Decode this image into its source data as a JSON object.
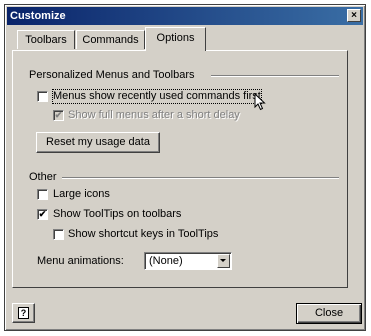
{
  "window": {
    "title": "Customize",
    "close_glyph": "×"
  },
  "tabs": [
    {
      "label": "Toolbars",
      "active": false
    },
    {
      "label": "Commands",
      "active": false
    },
    {
      "label": "Options",
      "active": true
    }
  ],
  "personalized": {
    "heading": "Personalized Menus and Toolbars",
    "recent_first": {
      "label": "Menus show recently used commands first",
      "checked": false
    },
    "full_menus_delay": {
      "label": "Show full menus after a short delay",
      "checked": true,
      "enabled": false
    },
    "reset_button": "Reset my usage data"
  },
  "other": {
    "heading": "Other",
    "large_icons": {
      "label": "Large icons",
      "checked": false
    },
    "show_tooltips": {
      "label": "Show ToolTips on toolbars",
      "checked": true
    },
    "shortcut_keys": {
      "label": "Show shortcut keys in ToolTips",
      "checked": false
    },
    "menu_animations_label": "Menu animations:",
    "menu_animations_value": "(None)"
  },
  "footer": {
    "help_glyph": "?",
    "close_button": "Close"
  },
  "icons": {
    "help": "help-icon",
    "close": "close-icon",
    "cursor": "mouse-pointer-icon"
  },
  "colors": {
    "titlebar_start": "#0a246a",
    "titlebar_end": "#3a6ea5",
    "face": "#d4d0c8"
  },
  "check_glyph": "✔"
}
